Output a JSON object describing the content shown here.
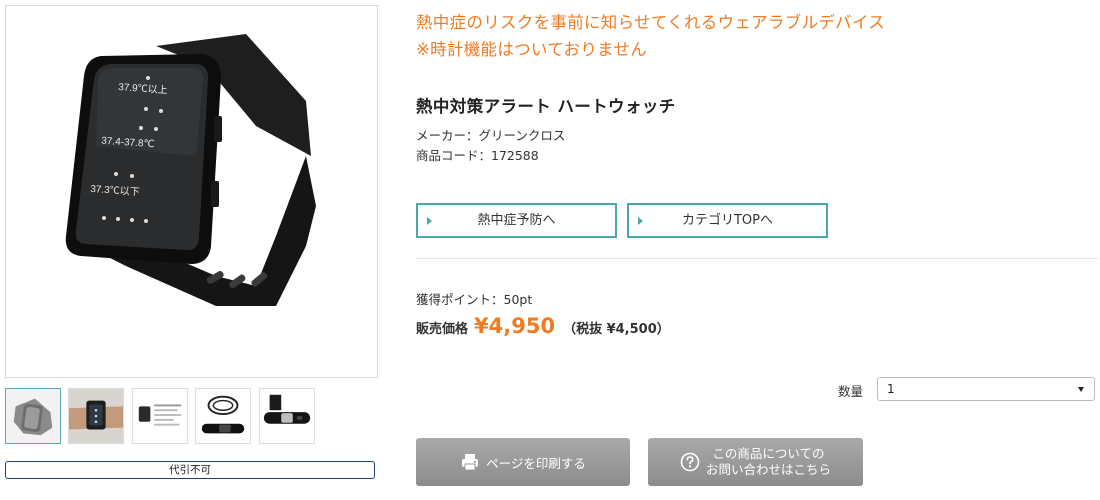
{
  "gallery": {
    "main_image": {
      "icon": "smartwatch-photo",
      "screen_labels": [
        "37.9℃以上",
        "37.4-37.8℃",
        "37.3℃以下"
      ]
    },
    "thumbnails": [
      {
        "icon": "smartwatch-thumbnail",
        "selected": true
      },
      {
        "icon": "wrist-wearing-thumbnail",
        "selected": false
      },
      {
        "icon": "package-contents-thumbnail",
        "selected": false
      },
      {
        "icon": "charger-cable-thumbnail",
        "selected": false
      },
      {
        "icon": "band-detail-thumbnail",
        "selected": false
      }
    ],
    "status_label": "代引不可"
  },
  "product": {
    "catch_line1": "熱中症のリスクを事前に知らせてくれるウェアラブルデバイス",
    "catch_line2": "※時計機能はついておりません",
    "name": "熱中対策アラート ハートウォッチ",
    "maker": "メーカー：グリーンクロス",
    "code": "商品コード：172588",
    "points": "獲得ポイント：50pt",
    "price_label": "販売価格",
    "price": "¥4,950",
    "price_tax_excluded": "（税抜 ¥4,500）"
  },
  "nav_buttons": {
    "heatstroke": "熱中症予防へ",
    "category_top": "カテゴリTOPへ"
  },
  "quantity": {
    "label": "数量",
    "selected": "1"
  },
  "actions": {
    "print": "ページを印刷する",
    "inquiry_line1": "この商品についての",
    "inquiry_line2": "お問い合わせはこちら"
  },
  "colors": {
    "accent_orange": "#ef7b23",
    "teal_border": "#4aa8a8",
    "navy_border": "#1f3f73",
    "gray_button": "#9a9a9a"
  }
}
